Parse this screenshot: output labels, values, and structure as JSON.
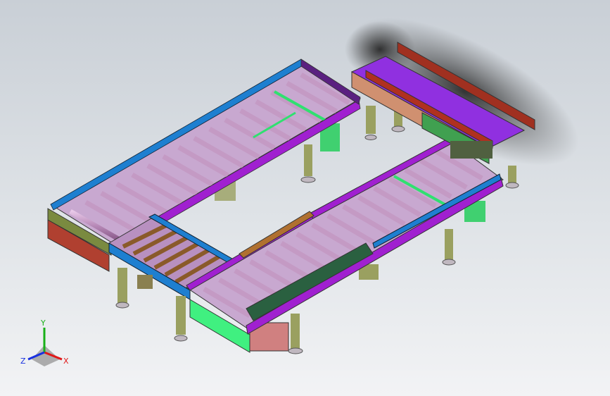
{
  "triad": {
    "x_label": "X",
    "y_label": "Y",
    "z_label": "Z",
    "x_color": "#e01818",
    "y_color": "#18b018",
    "z_color": "#1830e0"
  },
  "colors": {
    "frame_purple": "#a020d0",
    "frame_blue": "#1e7fd0",
    "roller": "#c8a0c8",
    "leg_olive": "#9aa060",
    "guard_green": "#40d070",
    "panel_red": "#b04030",
    "feet": "#c0b8c0",
    "background_top": "#c9cfd6",
    "background_bottom": "#f2f3f5"
  }
}
